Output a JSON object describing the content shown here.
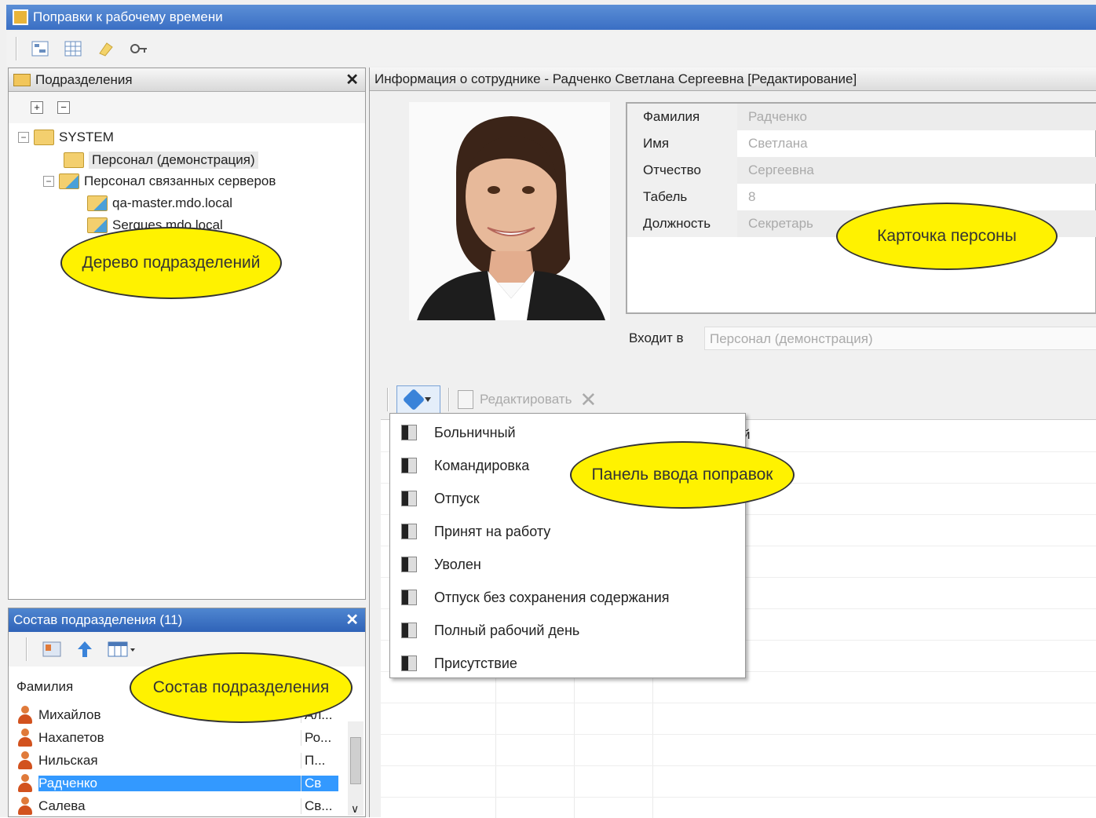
{
  "window": {
    "title": "Поправки к рабочему времени"
  },
  "toolbar": {
    "icons": [
      "tree-icon",
      "grid-icon",
      "notes-icon",
      "key-icon"
    ]
  },
  "departments": {
    "title": "Подразделения",
    "close": "✕",
    "expand_all": "+",
    "collapse_all": "−",
    "tree": [
      {
        "label": "SYSTEM",
        "expander": "−"
      },
      {
        "label": "Персонал (демонстрация)"
      },
      {
        "label": "Персонал связанных серверов",
        "expander": "−"
      },
      {
        "label": "qa-master.mdo.local"
      },
      {
        "label": "Sergues.mdo.local"
      }
    ],
    "callout": "Дерево подразделений"
  },
  "members": {
    "title": "Состав подразделения (11)",
    "close": "✕",
    "column": "Фамилия",
    "rows": [
      {
        "name": "Михайлов",
        "pos": "Ал..."
      },
      {
        "name": "Нахапетов",
        "pos": "Ро..."
      },
      {
        "name": "Нильская",
        "pos": "П..."
      },
      {
        "name": "Радченко",
        "pos": "Св",
        "selected": true
      },
      {
        "name": "Салева",
        "pos": "Св..."
      }
    ],
    "scroll_down": "∨",
    "callout": "Состав подразделения"
  },
  "employee": {
    "header": "Информация о сотруднике - Радченко Светлана Сергеевна [Редактирование]",
    "fields": [
      {
        "label": "Фамилия",
        "value": "Радченко"
      },
      {
        "label": "Имя",
        "value": "Светлана"
      },
      {
        "label": "Отчество",
        "value": "Сергеевна"
      },
      {
        "label": "Табель",
        "value": "8"
      },
      {
        "label": "Должность",
        "value": "Секретарь"
      }
    ],
    "belongs_label": "Входит в",
    "belongs_value": "Персонал (демонстрация)",
    "callout": "Карточка персоны"
  },
  "adjustments": {
    "edit_label": "Редактировать",
    "delete": "✕",
    "menu": [
      "Больничный",
      "Командировка",
      "Отпуск",
      "Принят на работу",
      "Уволен",
      "Отпуск без сохранения содержания",
      "Полный рабочий день",
      "Присутствие"
    ],
    "header_fragment": "й",
    "callout": "Панель ввода поправок"
  }
}
